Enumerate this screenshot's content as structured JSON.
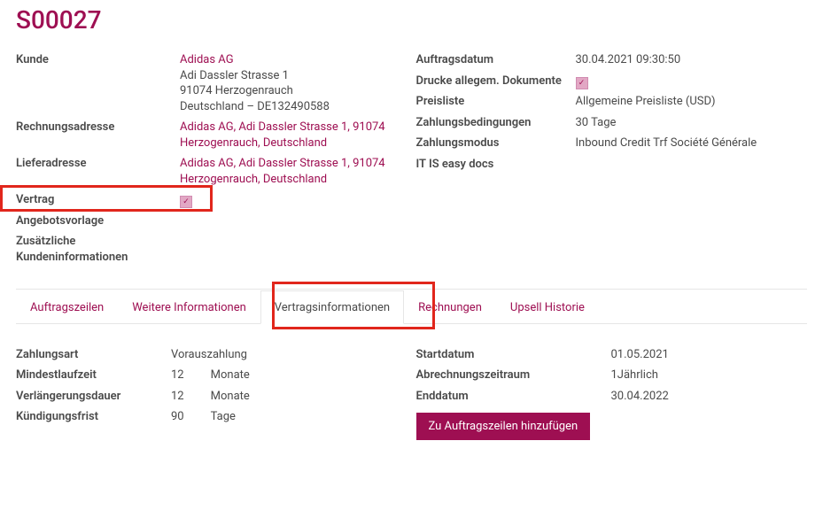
{
  "title": "S00027",
  "left": {
    "kunde_label": "Kunde",
    "kunde_name": "Adidas AG",
    "kunde_street": "Adi Dassler Strasse 1",
    "kunde_city": "91074 Herzogenrauch",
    "kunde_country": "Deutschland – DE132490588",
    "rechnungsadresse_label": "Rechnungsadresse",
    "rechnungsadresse_value": "Adidas AG, Adi Dassler Strasse 1, 91074 Herzogenrauch, Deutschland",
    "lieferadresse_label": "Lieferadresse",
    "lieferadresse_value": "Adidas AG, Adi Dassler Strasse 1, 91074 Herzogenrauch, Deutschland",
    "vertrag_label": "Vertrag",
    "vertrag_checked": true,
    "angebotsvorlage_label": "Angebotsvorlage",
    "zusatz_label": "Zusätzliche Kundeninformationen"
  },
  "right": {
    "auftragsdatum_label": "Auftragsdatum",
    "auftragsdatum_value": "30.04.2021 09:30:50",
    "drucke_label": "Drucke allegem. Dokumente",
    "drucke_checked": true,
    "preisliste_label": "Preisliste",
    "preisliste_value": "Allgemeine Preisliste (USD)",
    "zahlungsbedingungen_label": "Zahlungsbedingungen",
    "zahlungsbedingungen_value": "30 Tage",
    "zahlungsmodus_label": "Zahlungsmodus",
    "zahlungsmodus_value": "Inbound Credit Trf Société Générale",
    "itiseasy_label": "IT IS easy docs"
  },
  "tabs": {
    "t0": "Auftragszeilen",
    "t1": "Weitere Informationen",
    "t2": "Vertragsinformationen",
    "t3": "Rechnungen",
    "t4": "Upsell Historie"
  },
  "contract": {
    "zahlungsart_label": "Zahlungsart",
    "zahlungsart_value": "Vorauszahlung",
    "mindestlaufzeit_label": "Mindestlaufzeit",
    "mindestlaufzeit_n": "12",
    "mindestlaufzeit_u": "Monate",
    "verlaengerung_label": "Verlängerungsdauer",
    "verlaengerung_n": "12",
    "verlaengerung_u": "Monate",
    "kuendigung_label": "Kündigungsfrist",
    "kuendigung_n": "90",
    "kuendigung_u": "Tage",
    "startdatum_label": "Startdatum",
    "startdatum_value": "01.05.2021",
    "abrechnung_label": "Abrechnungszeitraum",
    "abrechnung_value": "1Jährlich",
    "enddatum_label": "Enddatum",
    "enddatum_value": "30.04.2022",
    "button_label": "Zu Auftragszeilen hinzufügen"
  }
}
